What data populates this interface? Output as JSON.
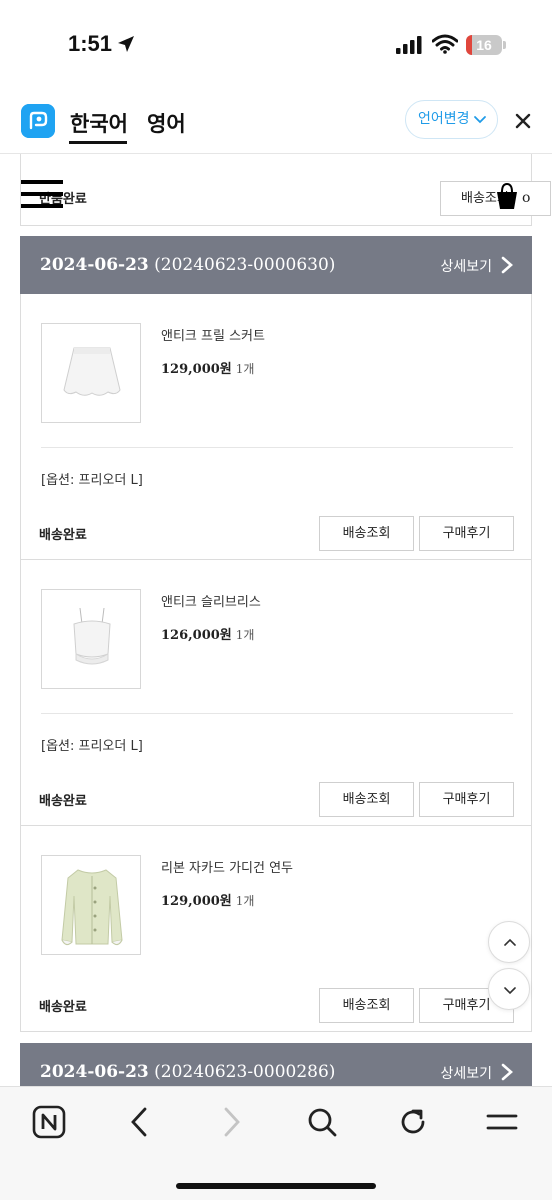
{
  "status_bar": {
    "time": "1:51",
    "battery_level": "16",
    "battery_fraction": 0.16
  },
  "translate_bar": {
    "lang_active": "한국어",
    "lang_inactive": "영어",
    "change_label": "언어변경"
  },
  "top_card": {
    "status": "반품완료",
    "track_label": "배송조회",
    "cut_text": "o"
  },
  "orders": [
    {
      "date": "2024-06-23",
      "number": "(20240623-0000630)",
      "detail_label": "상세보기",
      "items": [
        {
          "name": "앤티크 프릴 스커트",
          "price": "129,000원",
          "qty": "1개",
          "option": "[옵션: 프리오더 L]",
          "status": "배송완료",
          "track_label": "배송조회",
          "review_label": "구매후기"
        },
        {
          "name": "앤티크 슬리브리스",
          "price": "126,000원",
          "qty": "1개",
          "option": "[옵션: 프리오더 L]",
          "status": "배송완료",
          "track_label": "배송조회",
          "review_label": "구매후기"
        },
        {
          "name": "리본 자카드 가디건 연두",
          "price": "129,000원",
          "qty": "1개",
          "status": "배송완료",
          "track_label": "배송조회",
          "review_label": "구매후기"
        }
      ]
    },
    {
      "date": "2024-06-23",
      "number": "(20240623-0000286)",
      "detail_label": "상세보기"
    }
  ],
  "icons": {
    "toolbar": [
      "naver-n-icon",
      "back-arrow-icon",
      "forward-arrow-icon",
      "search-icon",
      "reload-icon",
      "menu-icon"
    ],
    "scroll": [
      "scroll-up-icon",
      "scroll-down-icon"
    ]
  },
  "colors": {
    "order_header_bg": "#767a86",
    "accent_blue": "#1f9be8",
    "battery_red": "#e0463c"
  }
}
